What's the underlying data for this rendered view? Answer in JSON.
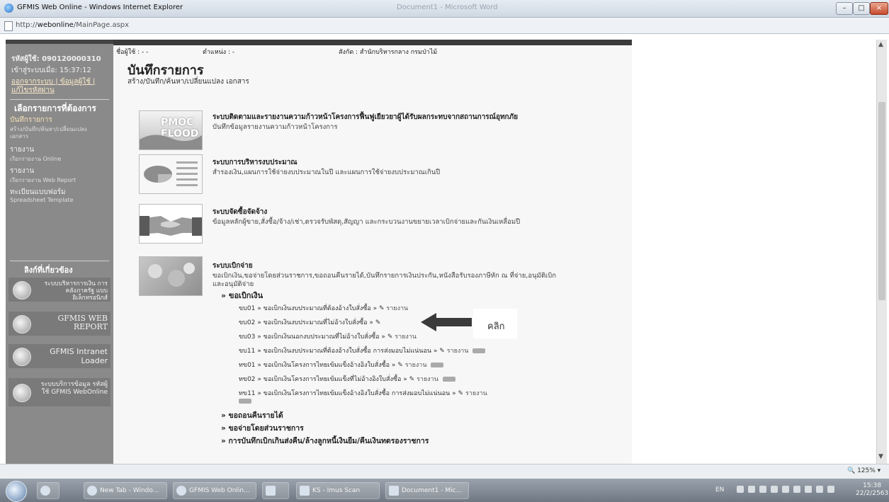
{
  "window": {
    "title": "GFMIS Web Online - Windows Internet Explorer",
    "faded_title": "Document1 - Microsoft Word",
    "min_label": "–",
    "max_label": "□",
    "close_label": "×"
  },
  "address": {
    "prefix": "http://",
    "host": "webonline",
    "path": "/MainPage.aspx"
  },
  "sidebar": {
    "user_code_label": "รหัสผู้ใช้: 090120000310",
    "login_time": "เข้าสู่ระบบเมื่อ: 15:37:12",
    "logout_link": "ออกจากระบบ | ข้อมูลผู้ใช้ |",
    "change_password": "แก้ไขรหัสผ่าน",
    "menu_header": "เลือกรายการที่ต้องการ",
    "menu_items": [
      {
        "label": "บันทึกรายการ",
        "sub": "สร้าง/บันทึก/ค้นหา/เปลี่ยนแปลง"
      },
      {
        "label": "",
        "sub": "เอกสาร"
      },
      {
        "label": "รายงาน",
        "sub": "เรียกรายงาน Online"
      },
      {
        "label": "รายงาน",
        "sub": "เรียกรายงาน Web Report"
      },
      {
        "label": "ทะเบียนแบบฟอร์ม",
        "sub": "Spreadsheet Template"
      }
    ],
    "related_header": "ลิงก์ที่เกี่ยวข้อง",
    "related_links": [
      "ระบบบริหารการเงิน การคลังภาครัฐ แบบอิเล็กทรอนิกส์",
      "GFMIS WEB REPORT",
      "GFMIS Intranet Loader",
      "ระบบบริการข้อมูล รหัสผู้ใช้ GFMIS WebOnline"
    ]
  },
  "infobar": {
    "user": "ชื่อผู้ใช้ : - -",
    "position": "ตำแหน่ง : -",
    "department": "สังกัด : สำนักบริหารกลาง กรมป่าไม้"
  },
  "page": {
    "title": "บันทึกรายการ",
    "subtitle": "สร้าง/บันทึก/ค้นหา/เปลี่ยนแปลง เอกสาร"
  },
  "systems": [
    {
      "thumb": "PMOC FLOOD",
      "title": "ระบบติดตามและรายงานความก้าวหน้าโครงการฟื้นฟูเยียวยาผู้ได้รับผลกระทบจากสถานการณ์อุทกภัย",
      "desc": "บันทึกข้อมูลรายงานความก้าวหน้าโครงการ"
    },
    {
      "thumb": "",
      "title": "ระบบการบริหารงบประมาณ",
      "desc": "สำรองเงิน,แผนการใช้จ่ายงบประมาณในปี และแผนการใช้จ่ายงบประมาณเกินปี"
    },
    {
      "thumb": "",
      "title": "ระบบจัดซื้อจัดจ้าง",
      "desc": "ข้อมูลหลักผู้ขาย,สั่งซื้อ/จ้าง/เช่า,ตรวจรับพัสดุ,สัญญา และกระบวนงานขยายเวลาเบิกจ่ายและกันเงินเหลื่อมปี"
    },
    {
      "thumb": "",
      "title": "ระบบเบิกจ่าย",
      "desc": "ขอเบิกเงิน,ขอจ่ายโดยส่วนราชการ,ขอถอนคืนรายได้,บันทึกรายการเงินประกัน,หนังสือรับรองภาษีหัก ณ ที่จ่าย,อนุมัติเบิก",
      "desc2": "และอนุมัติจ่าย"
    }
  ],
  "disbursement": {
    "section_label": "» ขอเบิกเงิน",
    "items": [
      {
        "code": "ขบ01",
        "label": "» ขอเบิกเงินงบประมาณที่ต้องอ้างใบสั่งซื้อ »",
        "report": "รายงาน"
      },
      {
        "code": "ขบ02",
        "label": "» ขอเบิกเงินงบประมาณที่ไม่อ้างใบสั่งซื้อ »",
        "report": ""
      },
      {
        "code": "ขบ03",
        "label": "» ขอเบิกเงินนอกงบประมาณที่ไม่อ้างใบสั่งซื้อ »",
        "report": "รายงาน"
      },
      {
        "code": "ขบ11",
        "label": "» ขอเบิกเงินงบประมาณที่ต้องอ้างใบสั่งซื้อ การส่งมอบไม่แน่นอน »",
        "report": "รายงาน"
      },
      {
        "code": "ทข01",
        "label": "» ขอเบิกเงินโครงการไทยเข้มแข็งอ้างอิงใบสั่งซื้อ »",
        "report": "รายงาน"
      },
      {
        "code": "ทข02",
        "label": "» ขอเบิกเงินโครงการไทยเข้มแข็งที่ไม่อ้างอิงใบสั่งซื้อ »",
        "report": "รายงาน"
      },
      {
        "code": "ทข11",
        "label": "» ขอเบิกเงินโครงการไทยเข้มแข็งอ้างอิงใบสั่งซื้อ การส่งมอบไม่แน่นอน »",
        "report": "รายงาน"
      }
    ],
    "other_sections": [
      "» ขอถอนคืนรายได้",
      "» ขอจ่ายโดยส่วนราชการ",
      "» การบันทึกเบิกเกินส่งคืน/ล้างลูกหนี้เงินยืม/คืนเงินทดรองราชการ"
    ],
    "annotation": "คลิก"
  },
  "status": {
    "zoom": "125%"
  },
  "taskbar": {
    "items": [
      "New Tab - Windo...",
      "GFMIS Web Onlin...",
      "",
      "KS - Imus Scan",
      "Document1 - Mic..."
    ],
    "lang": "EN",
    "time": "15:38",
    "date": "22/2/2563"
  }
}
